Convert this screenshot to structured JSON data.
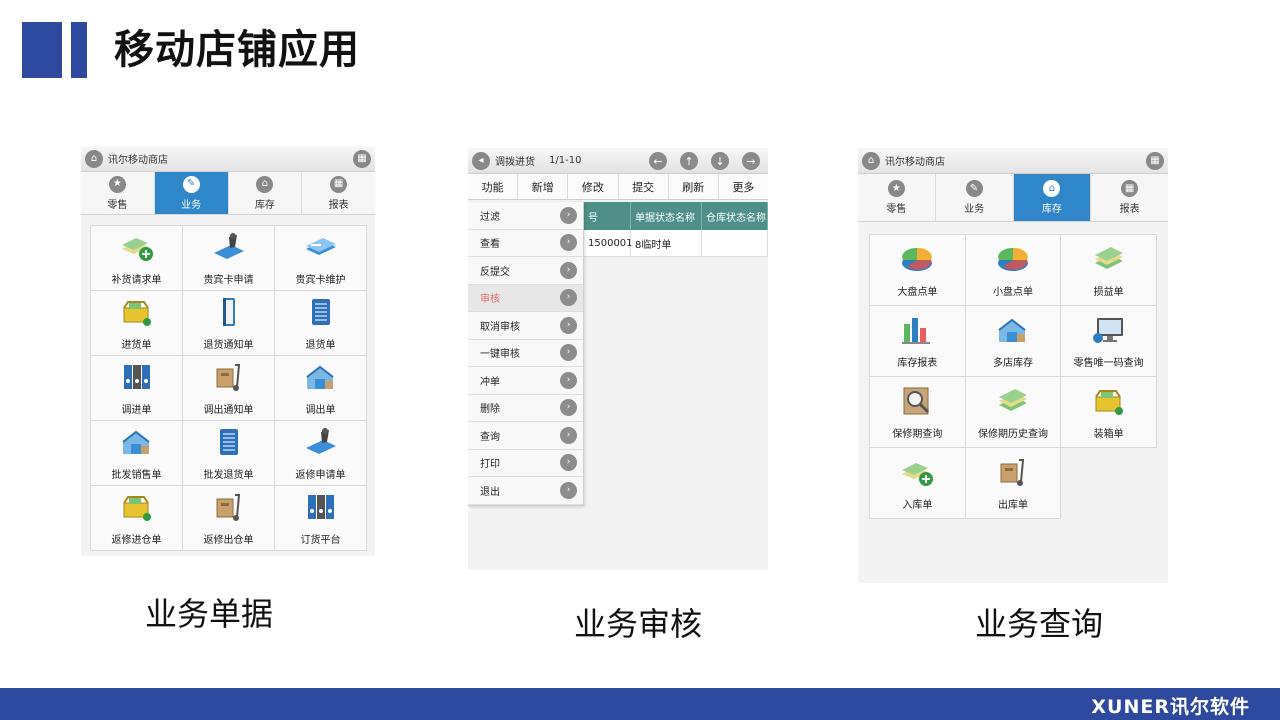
{
  "slide": {
    "title": "移动店铺应用",
    "captions": [
      "业务单据",
      "业务审核",
      "业务查询"
    ],
    "brand": "XUNER讯尔软件",
    "accent_color": "#2e4a9e"
  },
  "panel_left": {
    "header_title": "讯尔移动商店",
    "tabs": [
      {
        "label": "零售",
        "icon": "star-icon"
      },
      {
        "label": "业务",
        "icon": "pencil-icon",
        "active": true
      },
      {
        "label": "库存",
        "icon": "home-icon"
      },
      {
        "label": "报表",
        "icon": "grid-icon"
      }
    ],
    "items": [
      {
        "label": "补货请求单",
        "icon": "add-stock-icon"
      },
      {
        "label": "贵宾卡申请",
        "icon": "stamp-icon"
      },
      {
        "label": "贵宾卡维护",
        "icon": "card-edit-icon"
      },
      {
        "label": "进货单",
        "icon": "basket-in-icon"
      },
      {
        "label": "退货通知单",
        "icon": "book-icon"
      },
      {
        "label": "退货单",
        "icon": "notebook-icon"
      },
      {
        "label": "调进单",
        "icon": "binders-icon"
      },
      {
        "label": "调出通知单",
        "icon": "cart-box-icon"
      },
      {
        "label": "调出单",
        "icon": "warehouse-icon"
      },
      {
        "label": "批发销售单",
        "icon": "warehouse-icon"
      },
      {
        "label": "批发退货单",
        "icon": "notebook-icon"
      },
      {
        "label": "返修申请单",
        "icon": "stamp-icon"
      },
      {
        "label": "返修进仓单",
        "icon": "basket-in-icon"
      },
      {
        "label": "返修出仓单",
        "icon": "cart-box-icon"
      },
      {
        "label": "订货平台",
        "icon": "binders-icon"
      }
    ]
  },
  "panel_middle": {
    "header_title": "调拨进货",
    "pager": "1/1-10",
    "toolbar": [
      "功能",
      "新增",
      "修改",
      "提交",
      "刷新",
      "更多"
    ],
    "columns": [
      "号",
      "单据状态名称",
      "仓库状态名称"
    ],
    "row": [
      "1500001",
      "8临时单",
      ""
    ],
    "menu": [
      {
        "label": "过滤"
      },
      {
        "label": "查看"
      },
      {
        "label": "反提交"
      },
      {
        "label": "审核",
        "active": true
      },
      {
        "label": "取消审核"
      },
      {
        "label": "一键审核"
      },
      {
        "label": "冲单"
      },
      {
        "label": "删除"
      },
      {
        "label": "查询"
      },
      {
        "label": "打印"
      },
      {
        "label": "退出"
      }
    ]
  },
  "panel_right": {
    "header_title": "讯尔移动商店",
    "tabs": [
      {
        "label": "零售",
        "icon": "star-icon"
      },
      {
        "label": "业务",
        "icon": "pencil-icon"
      },
      {
        "label": "库存",
        "icon": "home-icon",
        "active": true
      },
      {
        "label": "报表",
        "icon": "grid-icon"
      }
    ],
    "items": [
      {
        "label": "大盘点单",
        "icon": "pie-chart-icon"
      },
      {
        "label": "小盘点单",
        "icon": "pie-chart-icon"
      },
      {
        "label": "损益单",
        "icon": "money-icon"
      },
      {
        "label": "库存报表",
        "icon": "bar-chart-icon"
      },
      {
        "label": "多店库存",
        "icon": "warehouse-icon"
      },
      {
        "label": "零售唯一码查询",
        "icon": "monitor-icon"
      },
      {
        "label": "保修期查询",
        "icon": "magnifier-icon"
      },
      {
        "label": "保修期历史查询",
        "icon": "money-icon"
      },
      {
        "label": "装箱单",
        "icon": "basket-in-icon"
      },
      {
        "label": "入库单",
        "icon": "add-stock-icon"
      },
      {
        "label": "出库单",
        "icon": "cart-box-icon"
      }
    ]
  }
}
